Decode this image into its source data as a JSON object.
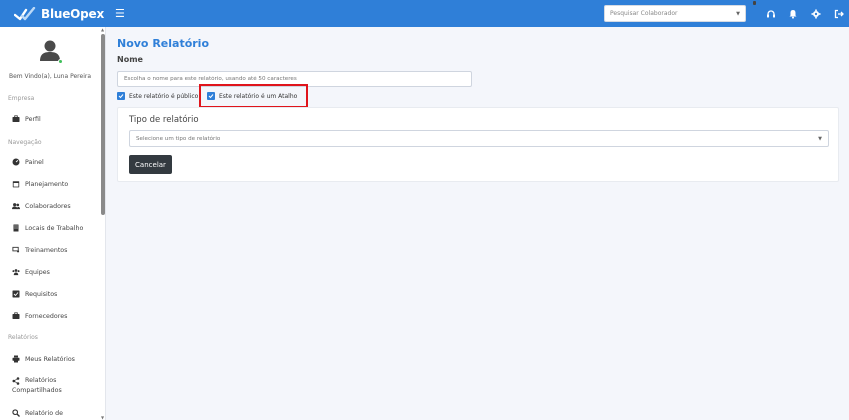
{
  "brand": {
    "name": "BlueOpex"
  },
  "topbar": {
    "search_placeholder": "Pesquisar Colaborador",
    "icons": [
      "menu-icon",
      "headset-icon",
      "bell-icon",
      "gear-icon",
      "logout-icon"
    ]
  },
  "sidebar": {
    "welcome": "Bem Vindo(a), Luna Pereira",
    "sections": {
      "empresa": "Empresa",
      "navegacao": "Navegação",
      "relatorios": "Relatórios"
    },
    "items": {
      "perfil": "Perfil",
      "painel": "Painel",
      "planejamento": "Planejamento",
      "colaboradores": "Colaboradores",
      "locais": "Locais de Trabalho",
      "treinamentos": "Treinamentos",
      "equipes": "Equipes",
      "requisitos": "Requisitos",
      "fornecedores": "Fornecedores",
      "meus_relatorios": "Meus Relatórios",
      "compartilhados_1": "Relatórios",
      "compartilhados_2": "Compartilhados",
      "relatorio_de": "Relatório de"
    }
  },
  "form": {
    "title": "Novo Relatório",
    "name_label": "Nome",
    "name_placeholder": "Escolha o nome para este relatório, usando até 50 caracteres",
    "public_label": "Este relatório é público",
    "public_checked": true,
    "shortcut_label": "Este relatório é um Atalho",
    "shortcut_checked": true,
    "type_title": "Tipo de relatório",
    "type_placeholder": "Selecione um tipo de relatório",
    "cancel_label": "Cancelar"
  },
  "colors": {
    "brand_blue": "#2f7fd8",
    "highlight_red": "#e0141b",
    "button_dark": "#333a40"
  }
}
